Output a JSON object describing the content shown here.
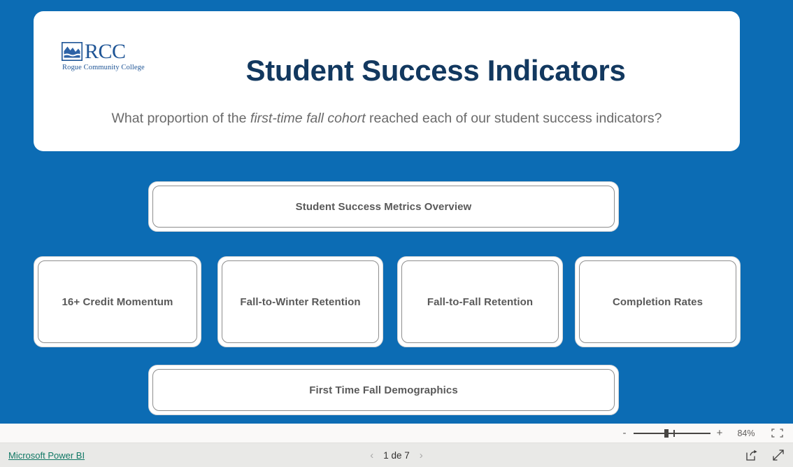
{
  "report": {
    "brand": {
      "logo_icon": "rcc-mountain-logo-icon",
      "acronym": "RCC",
      "full_name": "Rogue Community College",
      "logo_color": "#1F5596"
    },
    "title": "Student Success Indicators",
    "subtitle_part1": "What proportion of the ",
    "subtitle_emphasis": "first-time fall cohort",
    "subtitle_part2": " reached each of our student success indicators?",
    "canvas_color": "#0C6CB4",
    "title_color": "#12385F",
    "subtitle_color": "#6A6A6A"
  },
  "nav_buttons": {
    "overview": "Student Success Metrics Overview",
    "credit_momentum": "16+ Credit Momentum",
    "fall_to_winter": "Fall-to-Winter Retention",
    "fall_to_fall": "Fall-to-Fall Retention",
    "completion_rates": "Completion Rates",
    "demographics": "First Time Fall Demographics"
  },
  "zoom_bar": {
    "zoom_out_label": "-",
    "zoom_in_label": "+",
    "zoom_level": "84%",
    "fit_icon": "fit-to-page-icon",
    "slider_position_percent": 40
  },
  "footer": {
    "powerbi_label": "Microsoft Power BI",
    "powerbi_link_color": "#117865",
    "prev_icon": "chevron-left-icon",
    "next_icon": "chevron-right-icon",
    "page_indicator": "1 de 7",
    "share_icon": "share-icon",
    "fullscreen_icon": "fullscreen-icon"
  }
}
